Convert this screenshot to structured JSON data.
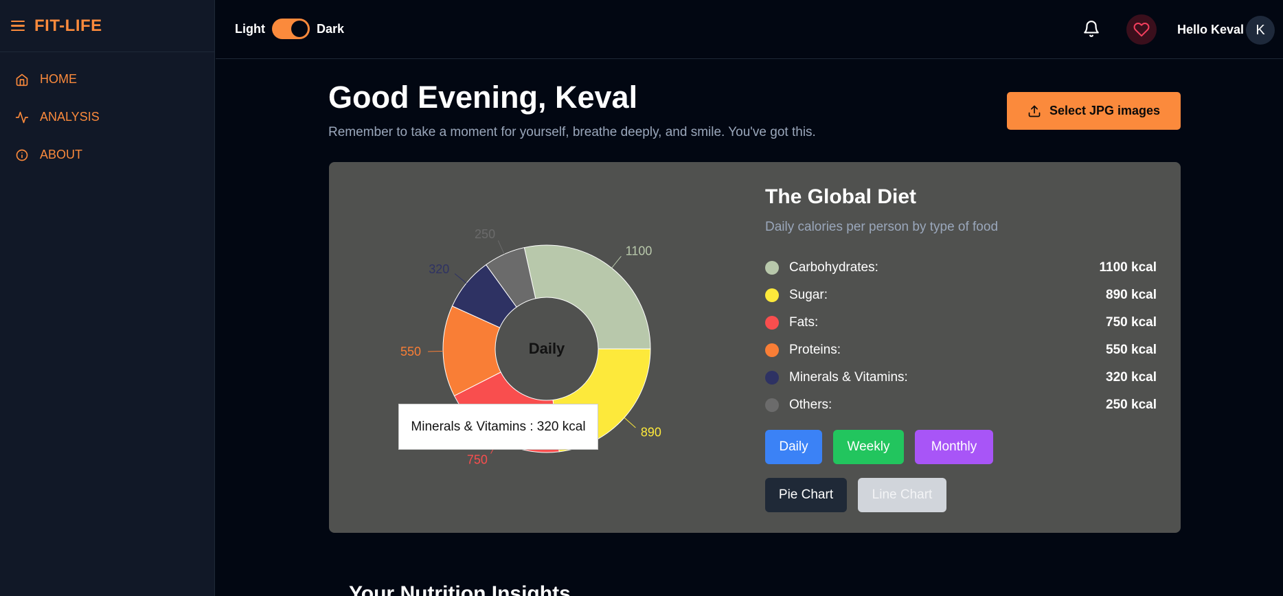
{
  "sidebar": {
    "brand": "FIT-LIFE",
    "items": [
      {
        "label": "HOME",
        "icon": "home-icon"
      },
      {
        "label": "ANALYSIS",
        "icon": "activity-icon"
      },
      {
        "label": "ABOUT",
        "icon": "info-icon"
      }
    ]
  },
  "topbar": {
    "light_label": "Light",
    "dark_label": "Dark",
    "greeting_user": "Hello Keval",
    "avatar_initial": "K"
  },
  "main": {
    "greeting": "Good Evening, Keval",
    "subtext": "Remember to take a moment for yourself, breathe deeply, and smile. You've got this.",
    "upload_label": "Select JPG images",
    "insights_title": "Your Nutrition Insights"
  },
  "card": {
    "title": "The Global Diet",
    "subtitle": "Daily calories per person by type of food",
    "center_label": "Daily",
    "tooltip": "Minerals & Vitamins : 320 kcal",
    "period_buttons": [
      "Daily",
      "Weekly",
      "Monthly"
    ],
    "chart_buttons": [
      "Pie Chart",
      "Line Chart"
    ]
  },
  "colors": {
    "accent": "#fb8a3c",
    "carbohydrates": "#b8c8ab",
    "sugar": "#fde93b",
    "fats": "#f94e4e",
    "proteins": "#f97e36",
    "minerals": "#2e3263",
    "others": "#6b6b6b"
  },
  "chart_data": {
    "type": "pie",
    "categories": [
      "Carbohydrates:",
      "Sugar:",
      "Fats:",
      "Proteins:",
      "Minerals & Vitamins:",
      "Others:"
    ],
    "values": [
      1100,
      890,
      750,
      550,
      320,
      250
    ],
    "value_labels": [
      "1100 kcal",
      "890 kcal",
      "750 kcal",
      "550 kcal",
      "320 kcal",
      "250 kcal"
    ],
    "data_labels": [
      "1100",
      "890",
      "750",
      "550",
      "320",
      "250"
    ],
    "colors": [
      "#b8c8ab",
      "#fde93b",
      "#f94e4e",
      "#f97e36",
      "#2e3263",
      "#6b6b6b"
    ],
    "unit": "kcal",
    "title": "The Global Diet",
    "subtitle": "Daily calories per person by type of food"
  }
}
